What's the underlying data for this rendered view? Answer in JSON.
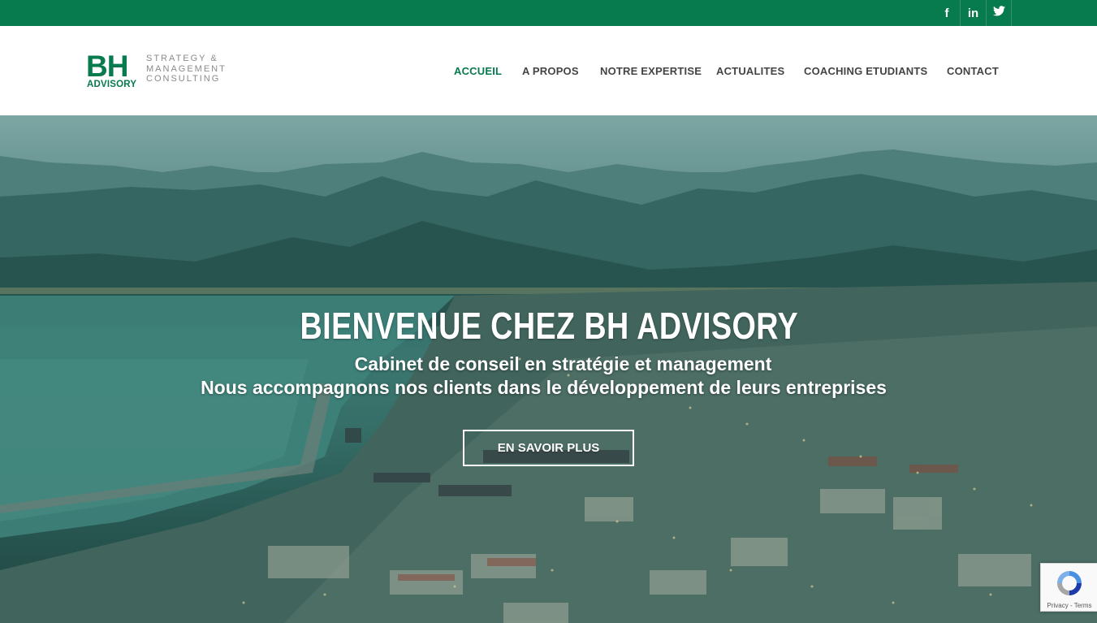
{
  "social": {
    "facebook_glyph": "f",
    "linkedin_glyph": "in",
    "twitter_glyph": "🐦"
  },
  "logo": {
    "mark": "BH",
    "sub": "ADVISORY",
    "tagline_1": "STRATEGY &",
    "tagline_2": "MANAGEMENT",
    "tagline_3": "CONSULTING"
  },
  "nav": {
    "items": [
      "ACCUEIL",
      "A PROPOS",
      "NOTRE EXPERTISE",
      "ACTUALITES",
      "COACHING ETUDIANTS",
      "CONTACT"
    ],
    "active_index": 0
  },
  "hero": {
    "title": "BIENVENUE CHEZ BH ADVISORY",
    "subtitle_1": "Cabinet de conseil en stratégie et management",
    "subtitle_2": "Nous accompagnons nos clients dans le développement de leurs entreprises",
    "cta_label": "EN SAVOIR PLUS"
  },
  "recaptcha": {
    "links": "Privacy - Terms"
  },
  "colors": {
    "brand_green": "#077a4e",
    "nav_text": "#444444"
  }
}
